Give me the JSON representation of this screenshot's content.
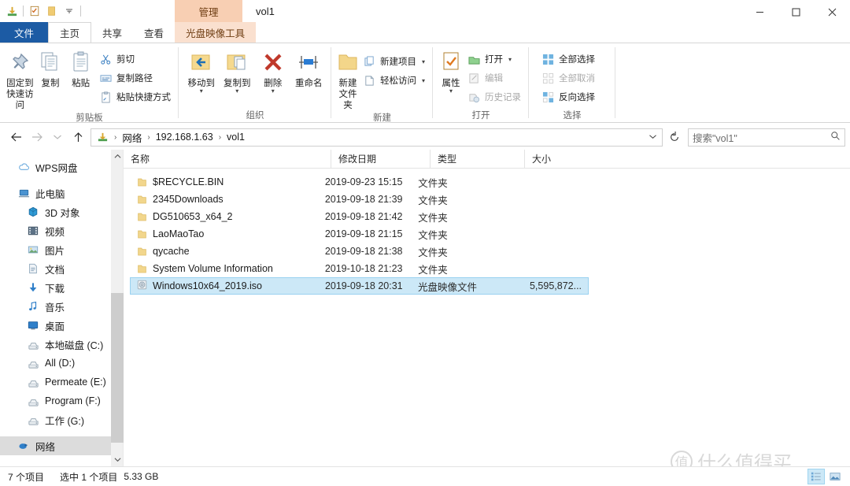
{
  "titlebar": {
    "quick_access": [
      {
        "name": "download-folder-icon",
        "label": "下载"
      },
      {
        "name": "properties-icon",
        "label": "属性"
      },
      {
        "name": "new-folder-icon",
        "label": "新建文件夹"
      },
      {
        "name": "customize-qat-caret",
        "label": "▾"
      }
    ],
    "contextual_header": "管理",
    "window_title": "vol1",
    "minimize": "—",
    "maximize": "□",
    "close": "✕"
  },
  "tabs": [
    {
      "label": "文件",
      "kind": "file"
    },
    {
      "label": "主页",
      "kind": "active"
    },
    {
      "label": "共享",
      "kind": "normal"
    },
    {
      "label": "查看",
      "kind": "normal"
    },
    {
      "label": "光盘映像工具",
      "kind": "contextual"
    }
  ],
  "ribbon_right": {
    "collapse_label": "^",
    "help_label": "?"
  },
  "ribbon": {
    "groups": [
      {
        "label": "剪贴板",
        "big": [
          {
            "icon": "pin-icon",
            "label": "固定到\n快速访问",
            "line1": "固定到",
            "line2": "快速访问"
          },
          {
            "icon": "copy-icon",
            "label": "复制",
            "line1": "复制",
            "line2": ""
          },
          {
            "icon": "paste-icon",
            "label": "粘贴",
            "line1": "粘贴",
            "line2": ""
          }
        ],
        "small": [
          {
            "icon": "scissors-icon",
            "label": "剪切",
            "dim": false
          },
          {
            "icon": "copy-path-icon",
            "label": "复制路径",
            "dim": false
          },
          {
            "icon": "paste-shortcut-icon",
            "label": "粘贴快捷方式",
            "dim": false
          }
        ]
      },
      {
        "label": "组织",
        "big": [
          {
            "icon": "move-to-icon",
            "line1": "移动到",
            "line2": "",
            "caret": true
          },
          {
            "icon": "copy-to-icon",
            "line1": "复制到",
            "line2": "",
            "caret": true
          },
          {
            "icon": "delete-icon",
            "line1": "删除",
            "line2": "",
            "caret": true
          },
          {
            "icon": "rename-icon",
            "line1": "重命名",
            "line2": "",
            "caret": false
          }
        ],
        "small": []
      },
      {
        "label": "新建",
        "big": [
          {
            "icon": "new-folder-icon",
            "line1": "新建",
            "line2": "文件夹",
            "caret": false
          }
        ],
        "small": [
          {
            "icon": "new-item-icon",
            "label": "新建项目",
            "dim": false,
            "caret": true
          },
          {
            "icon": "easy-access-icon",
            "label": "轻松访问",
            "dim": false,
            "caret": true
          }
        ]
      },
      {
        "label": "打开",
        "big": [
          {
            "icon": "properties-icon",
            "line1": "属性",
            "line2": "",
            "caret": true
          }
        ],
        "small": [
          {
            "icon": "open-icon",
            "label": "打开",
            "dim": false,
            "caret": true
          },
          {
            "icon": "edit-icon",
            "label": "编辑",
            "dim": true,
            "caret": false
          },
          {
            "icon": "history-icon",
            "label": "历史记录",
            "dim": true,
            "caret": false
          }
        ]
      },
      {
        "label": "选择",
        "big": [],
        "small": [
          {
            "icon": "select-all-icon",
            "label": "全部选择",
            "dim": false,
            "caret": false
          },
          {
            "icon": "select-none-icon",
            "label": "全部取消",
            "dim": true,
            "caret": false
          },
          {
            "icon": "invert-selection-icon",
            "label": "反向选择",
            "dim": false,
            "caret": false
          }
        ]
      }
    ]
  },
  "addressbar": {
    "back": "←",
    "forward": "→",
    "recent_caret": "⌄",
    "up": "↑",
    "crumbs": [
      "网络",
      "192.168.1.63",
      "vol1"
    ],
    "crumb_separator": "›",
    "dropdown_caret": "⌄",
    "refresh": "↻",
    "search_placeholder": "搜索\"vol1\"",
    "search_value": "",
    "search_icon": "search-icon"
  },
  "navpane": {
    "items": [
      {
        "label": "WPS网盘",
        "icon": "cloud-icon",
        "indent": false,
        "spacer_before": false,
        "selected": false
      },
      {
        "label": "此电脑",
        "icon": "this-pc-icon",
        "indent": false,
        "spacer_before": true,
        "selected": false
      },
      {
        "label": "3D 对象",
        "icon": "3d-objects-icon",
        "indent": true,
        "spacer_before": false,
        "selected": false
      },
      {
        "label": "视频",
        "icon": "videos-icon",
        "indent": true,
        "spacer_before": false,
        "selected": false
      },
      {
        "label": "图片",
        "icon": "pictures-icon",
        "indent": true,
        "spacer_before": false,
        "selected": false
      },
      {
        "label": "文档",
        "icon": "documents-icon",
        "indent": true,
        "spacer_before": false,
        "selected": false
      },
      {
        "label": "下载",
        "icon": "downloads-icon",
        "indent": true,
        "spacer_before": false,
        "selected": false
      },
      {
        "label": "音乐",
        "icon": "music-icon",
        "indent": true,
        "spacer_before": false,
        "selected": false
      },
      {
        "label": "桌面",
        "icon": "desktop-icon",
        "indent": true,
        "spacer_before": false,
        "selected": false
      },
      {
        "label": "本地磁盘 (C:)",
        "icon": "drive-icon",
        "indent": true,
        "spacer_before": false,
        "selected": false
      },
      {
        "label": "All (D:)",
        "icon": "drive-icon",
        "indent": true,
        "spacer_before": false,
        "selected": false
      },
      {
        "label": "Permeate (E:)",
        "icon": "drive-icon",
        "indent": true,
        "spacer_before": false,
        "selected": false
      },
      {
        "label": "Program (F:)",
        "icon": "drive-icon",
        "indent": true,
        "spacer_before": false,
        "selected": false
      },
      {
        "label": "工作 (G:)",
        "icon": "drive-icon",
        "indent": true,
        "spacer_before": false,
        "selected": false
      },
      {
        "label": "网络",
        "icon": "network-icon",
        "indent": false,
        "spacer_before": true,
        "selected": true
      }
    ],
    "scroll_up": "⌃",
    "scroll_down": "⌄"
  },
  "filelist": {
    "columns": [
      {
        "label": "名称",
        "key": "name"
      },
      {
        "label": "修改日期",
        "key": "date"
      },
      {
        "label": "类型",
        "key": "type"
      },
      {
        "label": "大小",
        "key": "size"
      }
    ],
    "rows": [
      {
        "name": "$RECYCLE.BIN",
        "date": "2019-09-23 15:15",
        "type": "文件夹",
        "size": "",
        "icon": "folder-icon",
        "selected": false
      },
      {
        "name": "2345Downloads",
        "date": "2019-09-18 21:39",
        "type": "文件夹",
        "size": "",
        "icon": "folder-icon",
        "selected": false
      },
      {
        "name": "DG510653_x64_2",
        "date": "2019-09-18 21:42",
        "type": "文件夹",
        "size": "",
        "icon": "folder-icon",
        "selected": false
      },
      {
        "name": "LaoMaoTao",
        "date": "2019-09-18 21:15",
        "type": "文件夹",
        "size": "",
        "icon": "folder-icon",
        "selected": false
      },
      {
        "name": "qycache",
        "date": "2019-09-18 21:38",
        "type": "文件夹",
        "size": "",
        "icon": "folder-icon",
        "selected": false
      },
      {
        "name": "System Volume Information",
        "date": "2019-10-18 21:23",
        "type": "文件夹",
        "size": "",
        "icon": "folder-icon",
        "selected": false
      },
      {
        "name": "Windows10x64_2019.iso",
        "date": "2019-09-18 20:31",
        "type": "光盘映像文件",
        "size": "5,595,872...",
        "icon": "disc-image-icon",
        "selected": true
      }
    ]
  },
  "statusbar": {
    "item_count": "7 个项目",
    "selection": "选中 1 个项目",
    "selection_size": "5.33 GB",
    "view_details": "details-view-icon",
    "view_thumbnails": "thumbnails-view-icon"
  },
  "watermark": {
    "mark": "值",
    "text": "什么值得买"
  },
  "colors": {
    "file_tab_blue": "#1c5ba4",
    "contextual_peach": "#f8cfb3",
    "selection_blue": "#cce8f7",
    "selection_border": "#99d1f0",
    "help_blue": "#1a79c9"
  }
}
